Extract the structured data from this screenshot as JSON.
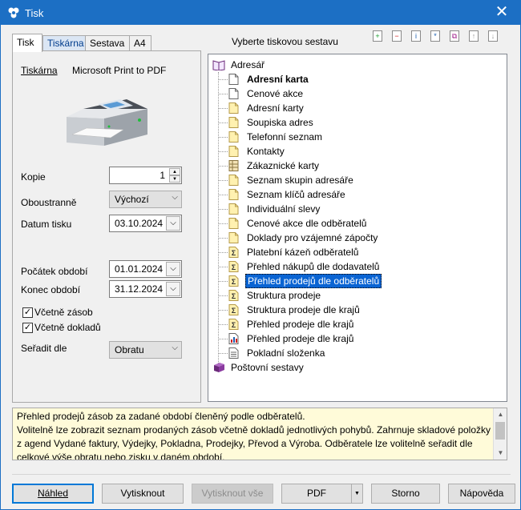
{
  "window": {
    "title": "Tisk",
    "close_glyph": "✕",
    "app_icon": "printer-app-icon"
  },
  "tabs": [
    "Tisk",
    "Tiskárna",
    "Sestava",
    "A4"
  ],
  "left": {
    "printer_label": "Tiskárna",
    "printer_value": "Microsoft Print to PDF",
    "copies_label": "Kopie",
    "copies_value": "1",
    "duplex_label": "Oboustranně",
    "duplex_value": "Výchozí",
    "print_date_label": "Datum tisku",
    "print_date_value": "03.10.2024",
    "period_start_label": "Počátek období",
    "period_start_value": "01.01.2024",
    "period_end_label": "Konec období",
    "period_end_value": "31.12.2024",
    "include_stock_label": "Včetně zásob",
    "include_stock_checked": true,
    "include_docs_label": "Včetně dokladů",
    "include_docs_checked": true,
    "sort_label": "Seřadit dle",
    "sort_value": "Obratu"
  },
  "right": {
    "header": "Vyberte tiskovou sestavu",
    "toolbar_icons": [
      "add-icon",
      "remove-icon",
      "info-icon",
      "star-icon",
      "copy-icon",
      "move-up-icon",
      "move-down-icon"
    ]
  },
  "tree": {
    "root": "Adresář",
    "items": [
      {
        "label": "Adresní karta",
        "icon": "doc",
        "bold": true
      },
      {
        "label": "Cenové akce",
        "icon": "doc"
      },
      {
        "label": "Adresní karty",
        "icon": "doc-yellow"
      },
      {
        "label": "Soupiska adres",
        "icon": "doc-yellow"
      },
      {
        "label": "Telefonní seznam",
        "icon": "doc-yellow"
      },
      {
        "label": "Kontakty",
        "icon": "doc-yellow"
      },
      {
        "label": "Zákaznické karty",
        "icon": "grid"
      },
      {
        "label": "Seznam skupin adresáře",
        "icon": "doc-yellow"
      },
      {
        "label": "Seznam klíčů adresáře",
        "icon": "doc-yellow"
      },
      {
        "label": "Individuální slevy",
        "icon": "doc-yellow"
      },
      {
        "label": "Cenové akce dle odběratelů",
        "icon": "doc-yellow"
      },
      {
        "label": "Doklady pro vzájemné zápočty",
        "icon": "doc-yellow"
      },
      {
        "label": "Platební kázeň odběratelů",
        "icon": "sigma"
      },
      {
        "label": "Přehled nákupů dle dodavatelů",
        "icon": "sigma"
      },
      {
        "label": "Přehled prodejů dle odběratelů",
        "icon": "sigma",
        "selected": true
      },
      {
        "label": "Struktura prodeje",
        "icon": "sigma"
      },
      {
        "label": "Struktura prodeje dle krajů",
        "icon": "sigma"
      },
      {
        "label": "Přehled prodeje dle krajů",
        "icon": "sigma"
      },
      {
        "label": "Přehled prodeje dle krajů",
        "icon": "chart"
      },
      {
        "label": "Pokladní složenka",
        "icon": "lines"
      }
    ],
    "second_root": "Poštovní sestavy"
  },
  "description": {
    "line1": "Přehled prodejů zásob za zadané období členěný podle odběratelů.",
    "line2": "Volitelně lze zobrazit seznam prodaných zásob včetně dokladů jednotlivých pohybů. Zahrnuje skladové položky z agend Vydané faktury, Výdejky, Pokladna, Prodejky, Převod a Výroba. Odběratele lze volitelně seřadit dle celkové výše obratu nebo zisku v daném období."
  },
  "buttons": {
    "preview": "Náhled",
    "print": "Vytisknout",
    "print_all": "Vytisknout vše",
    "pdf": "PDF",
    "cancel": "Storno",
    "help": "Nápověda"
  }
}
